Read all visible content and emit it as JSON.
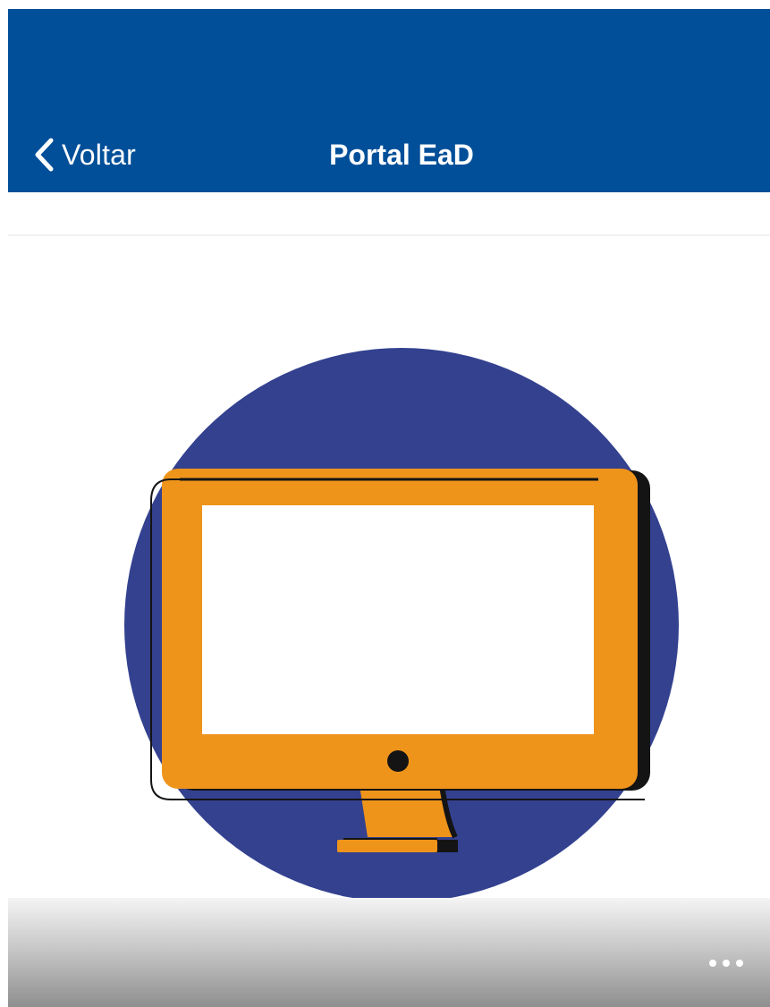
{
  "navbar": {
    "back_label": "Voltar",
    "title": "Portal EaD",
    "background_color": "#024f99",
    "back_icon": "chevron-left-icon"
  },
  "hero": {
    "illustration": "computer-monitor-illustration",
    "colors": {
      "circle": "#33418f",
      "monitor": "#ee941b",
      "screen": "#ffffff",
      "outline": "#141414"
    }
  },
  "footer_bar": {
    "more_icon": "more-horizontal-icon"
  }
}
